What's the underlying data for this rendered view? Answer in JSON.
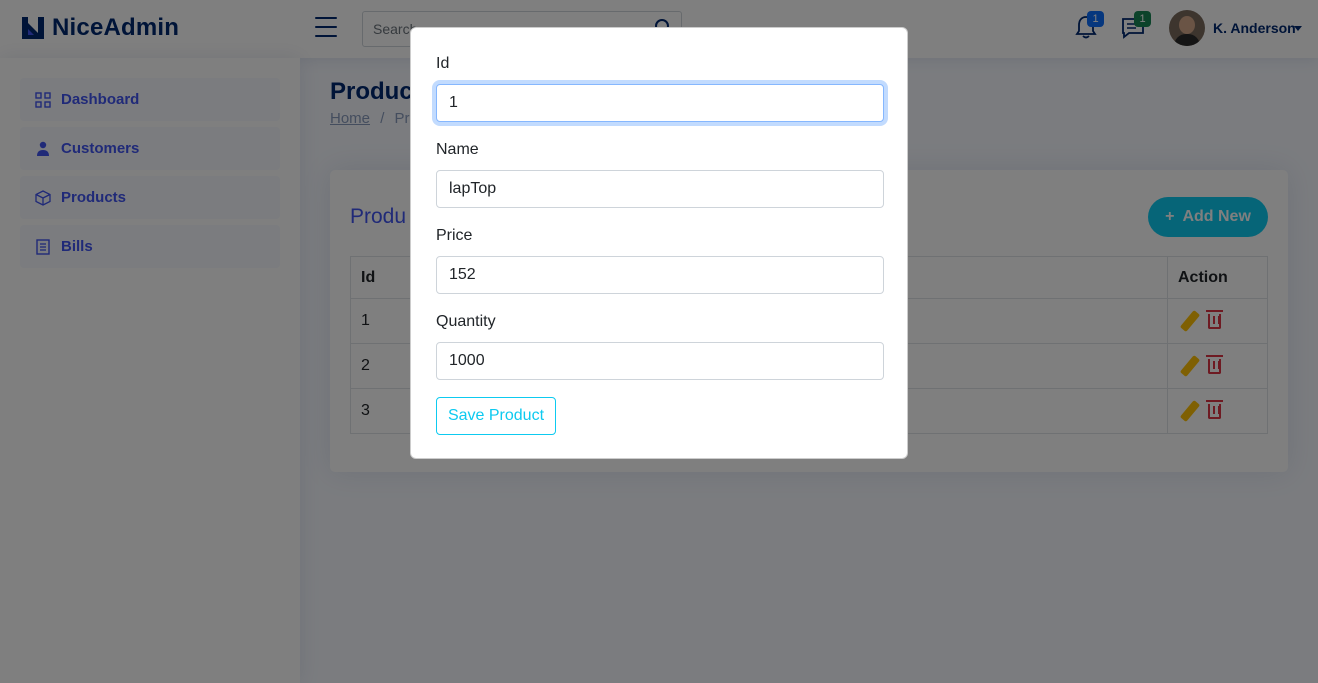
{
  "app": {
    "logo_text": "NiceAdmin"
  },
  "header": {
    "search_placeholder": "Search",
    "notifications_count": "1",
    "messages_count": "1",
    "user_name": "K. Anderson"
  },
  "sidebar": {
    "items": [
      {
        "label": "Dashboard",
        "icon": "grid-icon"
      },
      {
        "label": "Customers",
        "icon": "person-icon"
      },
      {
        "label": "Products",
        "icon": "box-icon"
      },
      {
        "label": "Bills",
        "icon": "receipt-icon"
      }
    ]
  },
  "main": {
    "page_title": "Product",
    "breadcrumb": {
      "home": "Home",
      "sep": "/",
      "current": "Pr"
    },
    "card_title": "Produ",
    "add_button": {
      "icon": "+",
      "label": "Add New"
    },
    "table": {
      "headers": {
        "id": "Id",
        "action": "Action"
      },
      "rows": [
        {
          "id": "1"
        },
        {
          "id": "2"
        },
        {
          "id": "3"
        }
      ]
    }
  },
  "modal": {
    "fields": {
      "id": {
        "label": "Id",
        "value": "1"
      },
      "name": {
        "label": "Name",
        "value": "lapTop"
      },
      "price": {
        "label": "Price",
        "value": "152"
      },
      "quantity": {
        "label": "Quantity",
        "value": "1000"
      }
    },
    "save_label": "Save Product"
  },
  "colors": {
    "brand": "#012970",
    "accent": "#4154f1",
    "info": "#0dcaf0",
    "warning": "#ffc107",
    "danger": "#dc3545"
  }
}
